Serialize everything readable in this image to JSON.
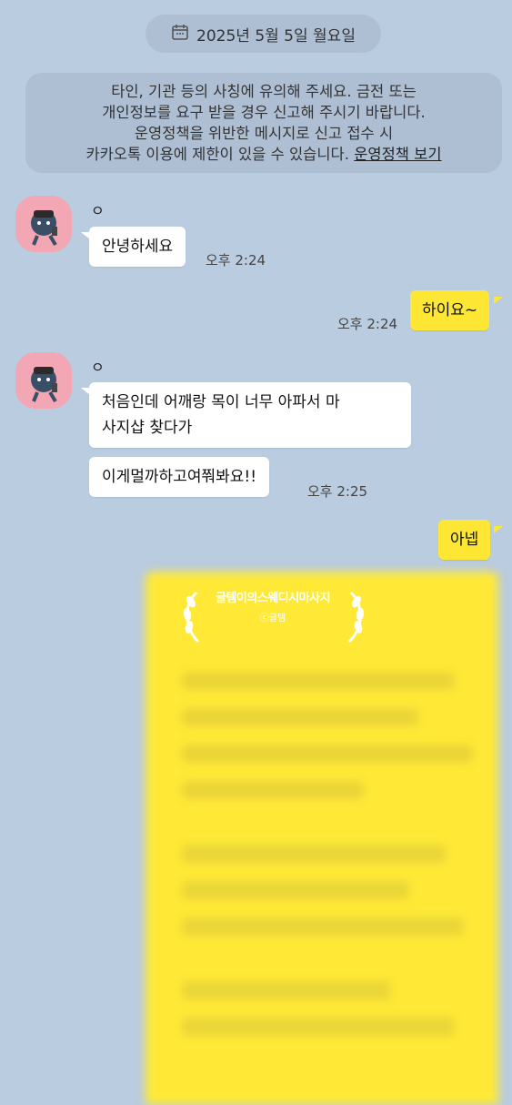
{
  "date_divider": {
    "icon": "calendar-icon",
    "text": "2025년 5월 5일 월요일"
  },
  "notice": {
    "lines": [
      "타인, 기관 등의 사칭에 유의해 주세요. 금전 또는",
      "개인정보를 요구 받을 경우 신고해 주시기 바랍니다.",
      "운영정책을 위반한 메시지로 신고 접수 시",
      "카카오톡 이용에 제한이 있을 수 있습니다."
    ],
    "link": "운영정책 보기"
  },
  "messages": {
    "m1": {
      "sender": "ㅇ",
      "text": "안녕하세요",
      "time": "오후 2:24"
    },
    "m2": {
      "text": "하이요~",
      "time": "오후 2:24"
    },
    "m3": {
      "sender": "ㅇ",
      "line1": "처음인데 어깨랑 목이 너무 아파서 마",
      "line2": "사지샵 찾다가",
      "text2": "이게멀까하고여쭤봐요!!",
      "time": "오후 2:25"
    },
    "m4": {
      "text": "아넵"
    }
  },
  "card": {
    "title": "글템이의스웨디시마사지",
    "subtitle": "ⓒ글템"
  },
  "colors": {
    "background": "#b9cce0",
    "outgoing": "#fee734",
    "incoming": "#ffffff",
    "avatar": "#f3a6b4"
  }
}
